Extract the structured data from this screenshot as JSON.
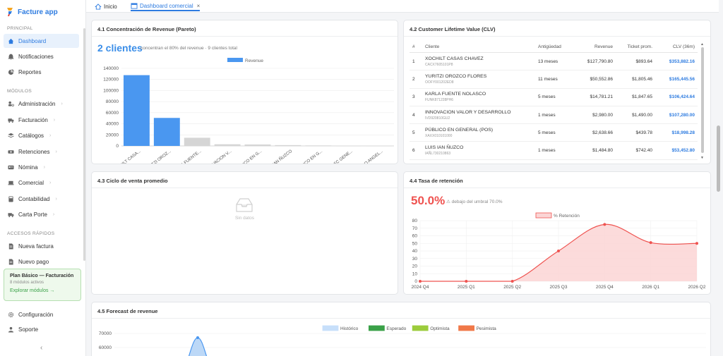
{
  "sidebar": {
    "brand": "Facture app",
    "section_principal": "PRINCIPAL",
    "principal_items": [
      {
        "label": "Dashboard",
        "icon": "home-icon"
      },
      {
        "label": "Notificaciones",
        "icon": "bell-icon"
      },
      {
        "label": "Reportes",
        "icon": "pie-chart-icon"
      }
    ],
    "section_modulos": "MÓDULOS",
    "modulos_items": [
      {
        "label": "Administración",
        "icon": "users-cog-icon"
      },
      {
        "label": "Facturación",
        "icon": "truck-icon"
      },
      {
        "label": "Catálogos",
        "icon": "layers-icon"
      },
      {
        "label": "Retenciones",
        "icon": "money-icon"
      },
      {
        "label": "Nómina",
        "icon": "id-card-icon"
      },
      {
        "label": "Comercial",
        "icon": "laptop-icon"
      },
      {
        "label": "Contabilidad",
        "icon": "calculator-icon"
      },
      {
        "label": "Carta Porte",
        "icon": "truck-icon"
      }
    ],
    "section_accesos": "ACCESOS RÁPIDOS",
    "accesos_items": [
      {
        "label": "Nueva factura",
        "icon": "document-icon"
      },
      {
        "label": "Nuevo pago",
        "icon": "document-icon"
      }
    ],
    "plan": {
      "title": "Plan Básico — Facturación",
      "subtitle": "8 módulos activos",
      "link": "Explorar módulos →"
    },
    "bottom_items": [
      {
        "label": "Configuración",
        "icon": "gear-icon"
      },
      {
        "label": "Soporte",
        "icon": "user-icon"
      }
    ],
    "collapse_glyph": "‹"
  },
  "tabs": [
    {
      "label": "Inicio",
      "icon": "home-icon"
    },
    {
      "label": "Dashboard comercial",
      "icon": "window-icon",
      "close": "×"
    }
  ],
  "pareto": {
    "title": "4.1 Concentración de Revenue (Pareto)",
    "big_value": "2 clientes",
    "subtitle": "concentran el 80% del revenue · 9 clientes total"
  },
  "clv": {
    "title": "4.2 Customer Lifetime Value (CLV)",
    "headers": [
      "#",
      "Cliente",
      "Antigüedad",
      "Revenue",
      "Ticket prom.",
      "CLV (36m)"
    ],
    "rows": [
      {
        "n": "1",
        "name": "XOCHILT CASAS CHAVEZ",
        "rfc": "CACX7605101P8",
        "age": "13 meses",
        "revenue": "$127,790.80",
        "ticket": "$893.64",
        "clv": "$353,882.16"
      },
      {
        "n": "2",
        "name": "YURITZI OROZCO FLORES",
        "rfc": "OOFY001202ED8",
        "age": "11 meses",
        "revenue": "$50,552.86",
        "ticket": "$1,805.46",
        "clv": "$165,445.56"
      },
      {
        "n": "3",
        "name": "KARLA FUENTE NOLASCO",
        "rfc": "FUNK871228PH6",
        "age": "5 meses",
        "revenue": "$14,781.21",
        "ticket": "$1,847.65",
        "clv": "$106,424.64"
      },
      {
        "n": "4",
        "name": "INNOVACION VALOR Y DESARROLLO",
        "rfc": "IVD920810GU2",
        "age": "1 meses",
        "revenue": "$2,980.00",
        "ticket": "$1,490.00",
        "clv": "$107,280.00"
      },
      {
        "n": "5",
        "name": "PÚBLICO EN GENERAL (POS)",
        "rfc": "XAXX010101000",
        "age": "5 meses",
        "revenue": "$2,638.66",
        "ticket": "$439.78",
        "clv": "$18,998.28"
      },
      {
        "n": "6",
        "name": "LUIS IAN ÑUZCO",
        "rfc": "IAÑL730210863",
        "age": "1 meses",
        "revenue": "$1,484.80",
        "ticket": "$742.40",
        "clv": "$53,452.80"
      }
    ]
  },
  "ciclo": {
    "title": "4.3 Ciclo de venta promedio",
    "empty": "Sin datos"
  },
  "retencion": {
    "title": "4.4 Tasa de retención",
    "big_value": "50.0%",
    "subtitle": "⚠ debajo del umbral 70.0%"
  },
  "forecast": {
    "title": "4.5 Forecast de revenue"
  },
  "colors": {
    "accent": "#2d7be0",
    "bar_blue": "#4a97f0",
    "bar_gray": "#d5d5d5",
    "red": "#ef5350",
    "green": "#3aa148"
  },
  "chart_data": [
    {
      "type": "bar",
      "categories": [
        "XOCHILT CASA...",
        "YURITZI OROZ...",
        "KARLA FUENTE...",
        "INNOVACION V...",
        "PÚBLICO EN G...",
        "LUIS IAN ÑUZCO",
        "PÚBLICO EN G...",
        "YurRFC GENE...",
        "PEDRO ANGEL..."
      ],
      "series": [
        {
          "name": "Revenue",
          "values": [
            127790.8,
            50552.86,
            14781.21,
            2980.0,
            2638.66,
            1484.8,
            900,
            400,
            200
          ]
        }
      ],
      "highlight_count": 2,
      "yticks": [
        "0",
        "20000",
        "40000",
        "60000",
        "80000",
        "100000",
        "120000",
        "140000"
      ],
      "ylim": [
        0,
        140000
      ],
      "legend": "top-center"
    },
    {
      "type": "area",
      "categories": [
        "2024 Q4",
        "2025 Q1",
        "2025 Q2",
        "2025 Q3",
        "2025 Q4",
        "2026 Q1",
        "2026 Q2"
      ],
      "series": [
        {
          "name": "% Retención",
          "values": [
            0,
            0,
            0,
            40,
            75,
            51,
            50
          ]
        }
      ],
      "yticks": [
        "0",
        "10",
        "20",
        "30",
        "40",
        "50",
        "60",
        "70",
        "80"
      ],
      "ylim": [
        0,
        80
      ],
      "legend": "top-center"
    },
    {
      "type": "area",
      "series": [
        {
          "name": "Histórico",
          "color": "#4a97f0"
        },
        {
          "name": "Esperado",
          "color": "#3aa148"
        },
        {
          "name": "Optimista",
          "color": "#9ccc3c"
        },
        {
          "name": "Pesimista",
          "color": "#f07848"
        }
      ],
      "yticks": [
        "60000",
        "70000"
      ],
      "legend": "top-center"
    }
  ]
}
